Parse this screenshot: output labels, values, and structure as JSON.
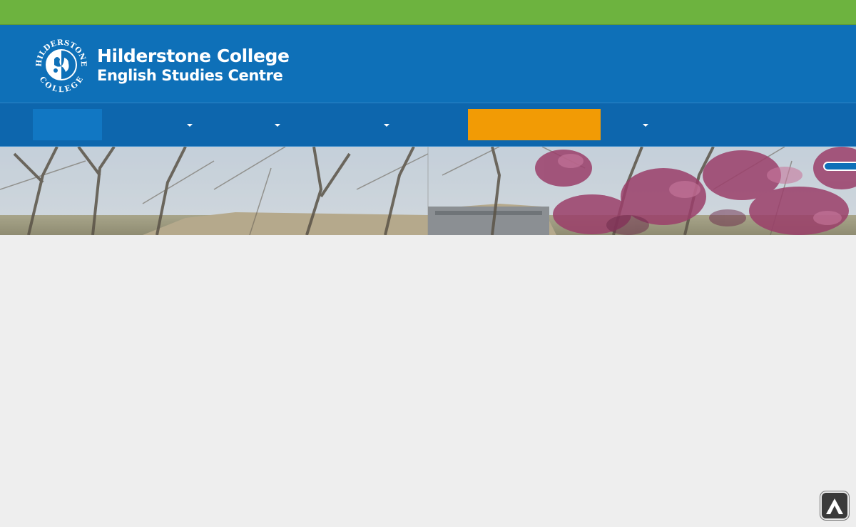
{
  "brand": {
    "name_line1": "Hilderstone College",
    "name_line2": "English Studies Centre",
    "seal_text_top": "HILDERSTONE",
    "seal_text_bottom": "COLLEGE"
  },
  "colors": {
    "top_bar": "#6db33f",
    "header": "#0e70b8",
    "nav": "#0d66ad",
    "nav_active": "#1177c3",
    "nav_highlight": "#f29b05",
    "page_background": "#eeeeee"
  },
  "nav": {
    "items": [
      {
        "id": "home",
        "has_dropdown": false
      },
      {
        "id": "item-2",
        "has_dropdown": true
      },
      {
        "id": "item-3",
        "has_dropdown": true
      },
      {
        "id": "item-4",
        "has_dropdown": true
      },
      {
        "id": "highlight",
        "has_dropdown": false
      },
      {
        "id": "item-6",
        "has_dropdown": true
      }
    ]
  },
  "icons": {
    "scroll_top": "chevron-up-icon",
    "dropdown": "caret-down-icon"
  }
}
